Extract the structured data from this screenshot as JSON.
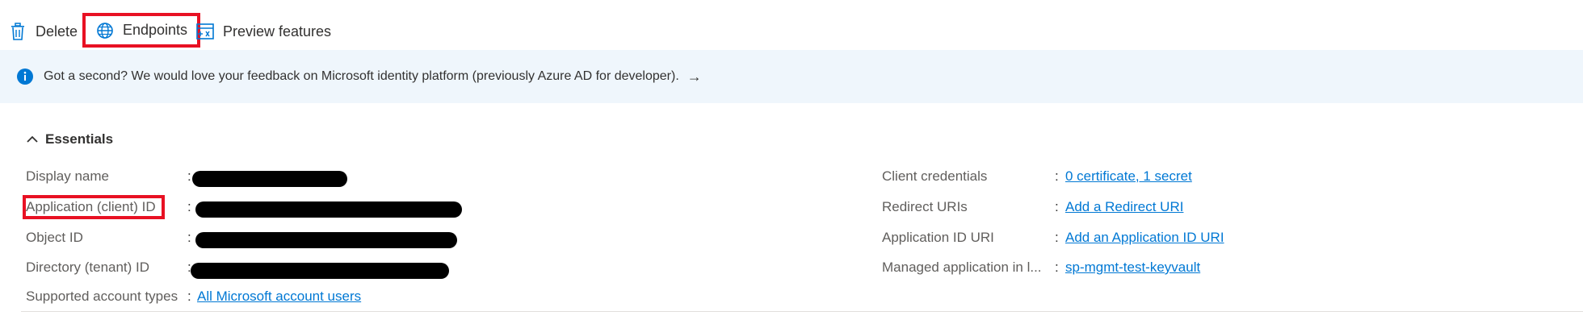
{
  "toolbar": {
    "delete_label": "Delete",
    "endpoints_label": "Endpoints",
    "preview_label": "Preview features"
  },
  "banner": {
    "text": "Got a second? We would love your feedback on Microsoft identity platform (previously Azure AD for developer).",
    "arrow": "→"
  },
  "essentials": {
    "title": "Essentials",
    "left": [
      {
        "label": "Display name",
        "value": ""
      },
      {
        "label": "Application (client) ID",
        "value": ""
      },
      {
        "label": "Object ID",
        "value": ""
      },
      {
        "label": "Directory (tenant) ID",
        "value": ""
      },
      {
        "label": "Supported account types",
        "value": "All Microsoft account users"
      }
    ],
    "right": [
      {
        "label": "Client credentials",
        "value": "0 certificate, 1 secret"
      },
      {
        "label": "Redirect URIs",
        "value": "Add a Redirect URI"
      },
      {
        "label": "Application ID URI",
        "value": "Add an Application ID URI"
      },
      {
        "label": "Managed application in l...",
        "value": "sp-mgmt-test-keyvault"
      }
    ]
  },
  "colors": {
    "accent": "#0078d4",
    "highlight": "#e81123",
    "banner_bg": "#eff6fc"
  },
  "icons": {
    "delete": "trash-icon",
    "endpoints": "globe-icon",
    "preview": "preview-features-icon",
    "banner": "info-icon",
    "essentials": "chevron-up-icon"
  }
}
